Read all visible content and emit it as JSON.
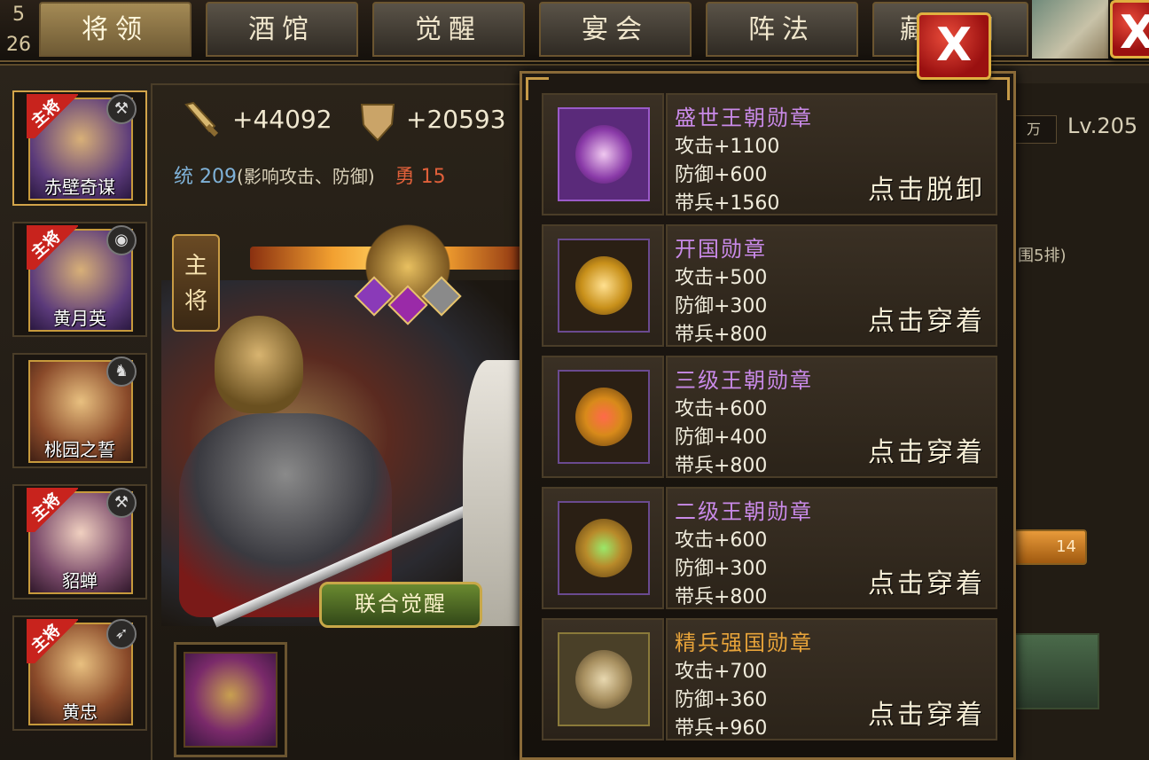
{
  "top_left": {
    "line1": "5",
    "line2": "26"
  },
  "tabs": [
    {
      "label": "将领",
      "active": true
    },
    {
      "label": "酒馆",
      "active": false
    },
    {
      "label": "觉醒",
      "active": false
    },
    {
      "label": "宴会",
      "active": false
    },
    {
      "label": "阵法",
      "active": false
    },
    {
      "label": "藏宝图",
      "active": false
    }
  ],
  "close_label": "X",
  "generals": [
    {
      "name": "赤壁奇谋",
      "main_tag": "主将",
      "selected": true,
      "badge_icon": "axe-icon"
    },
    {
      "name": "黄月英",
      "main_tag": "主将",
      "selected": false,
      "badge_icon": "cannon-icon"
    },
    {
      "name": "桃园之誓",
      "main_tag": "",
      "selected": false,
      "badge_icon": "horse-icon"
    },
    {
      "name": "貂蝉",
      "main_tag": "主将",
      "selected": false,
      "badge_icon": "axe-icon"
    },
    {
      "name": "黄忠",
      "main_tag": "主将",
      "selected": false,
      "badge_icon": "bow-icon"
    }
  ],
  "detail": {
    "attack_value": "+44092",
    "defense_value": "+20593",
    "tong_label": "统",
    "tong_value": "209",
    "tong_note": "(影响攻击、防御)",
    "yong_label": "勇",
    "yong_value": "15",
    "main_general_tag": "主将",
    "awaken_button": "联合觉醒"
  },
  "right_side": {
    "box_text": "万",
    "level": "Lv.205",
    "row_text": "围5排)",
    "orange_text": "14"
  },
  "medals": [
    {
      "name": "盛世王朝勋章",
      "name_color": "#c98ae8",
      "attack": "攻击+1100",
      "defense": "防御+600",
      "troops": "带兵+1560",
      "action": "点击脱卸",
      "frame": "#9a5ac8",
      "core": "#8a3aa8"
    },
    {
      "name": "开国勋章",
      "name_color": "#c98ae8",
      "attack": "攻击+500",
      "defense": "防御+300",
      "troops": "带兵+800",
      "action": "点击穿着",
      "frame": "#6a4a90",
      "core": "#c8901a"
    },
    {
      "name": "三级王朝勋章",
      "name_color": "#c98ae8",
      "attack": "攻击+600",
      "defense": "防御+400",
      "troops": "带兵+800",
      "action": "点击穿着",
      "frame": "#6a4a90",
      "core": "#d88a1a"
    },
    {
      "name": "二级王朝勋章",
      "name_color": "#c98ae8",
      "attack": "攻击+600",
      "defense": "防御+300",
      "troops": "带兵+800",
      "action": "点击穿着",
      "frame": "#6a4a90",
      "core": "#b88a2a"
    },
    {
      "name": "精兵强国勋章",
      "name_color": "#e8a43a",
      "attack": "攻击+700",
      "defense": "防御+360",
      "troops": "带兵+960",
      "action": "点击穿着",
      "frame": "#8a7a3a",
      "core": "#a89060"
    }
  ]
}
